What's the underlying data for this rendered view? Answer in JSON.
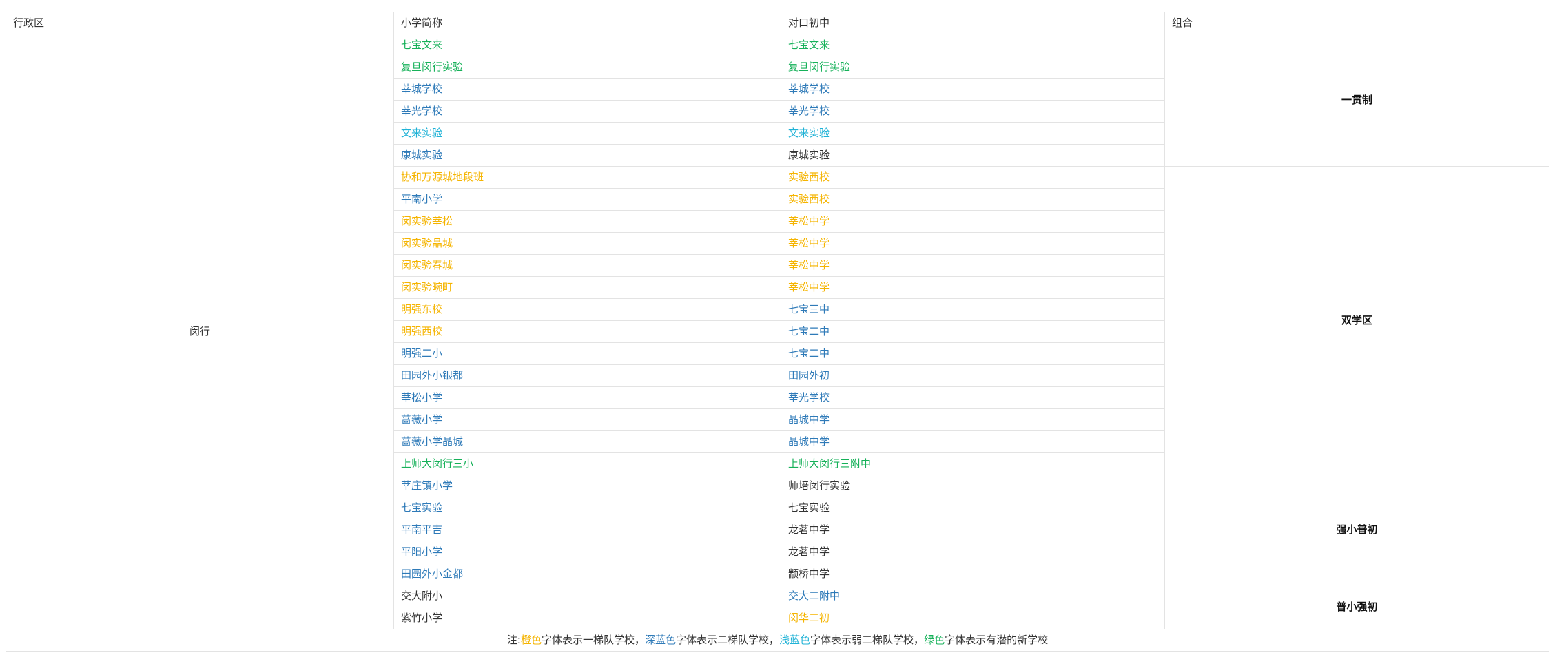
{
  "colors": {
    "orange": "#f5b400",
    "dark_blue": "#2e7ab8",
    "light_blue": "#1fb2d6",
    "green": "#16b159",
    "black": "#333333"
  },
  "table": {
    "headers": [
      "行政区",
      "小学简称",
      "对口初中",
      "组合"
    ],
    "district": "闵行",
    "groups": [
      "一贯制",
      "双学区",
      "强小普初",
      "普小强初"
    ],
    "rows": [
      {
        "primary": "七宝文来",
        "primary_color": "green",
        "middle": "七宝文来",
        "middle_color": "green"
      },
      {
        "primary": "复旦闵行实验",
        "primary_color": "green",
        "middle": "复旦闵行实验",
        "middle_color": "green"
      },
      {
        "primary": "莘城学校",
        "primary_color": "dark_blue",
        "middle": "莘城学校",
        "middle_color": "dark_blue"
      },
      {
        "primary": "莘光学校",
        "primary_color": "dark_blue",
        "middle": "莘光学校",
        "middle_color": "dark_blue"
      },
      {
        "primary": "文来实验",
        "primary_color": "light_blue",
        "middle": "文来实验",
        "middle_color": "light_blue"
      },
      {
        "primary": "康城实验",
        "primary_color": "dark_blue",
        "middle": "康城实验",
        "middle_color": "black"
      },
      {
        "primary": "协和万源城地段班",
        "primary_color": "orange",
        "middle": "实验西校",
        "middle_color": "orange"
      },
      {
        "primary": "平南小学",
        "primary_color": "dark_blue",
        "middle": "实验西校",
        "middle_color": "orange"
      },
      {
        "primary": "闵实验莘松",
        "primary_color": "orange",
        "middle": "莘松中学",
        "middle_color": "orange"
      },
      {
        "primary": "闵实验晶城",
        "primary_color": "orange",
        "middle": "莘松中学",
        "middle_color": "orange"
      },
      {
        "primary": "闵实验春城",
        "primary_color": "orange",
        "middle": "莘松中学",
        "middle_color": "orange"
      },
      {
        "primary": "闵实验畹町",
        "primary_color": "orange",
        "middle": "莘松中学",
        "middle_color": "orange"
      },
      {
        "primary": "明强东校",
        "primary_color": "orange",
        "middle": "七宝三中",
        "middle_color": "dark_blue"
      },
      {
        "primary": "明强西校",
        "primary_color": "orange",
        "middle": "七宝二中",
        "middle_color": "dark_blue"
      },
      {
        "primary": "明强二小",
        "primary_color": "dark_blue",
        "middle": "七宝二中",
        "middle_color": "dark_blue"
      },
      {
        "primary": "田园外小银都",
        "primary_color": "dark_blue",
        "middle": "田园外初",
        "middle_color": "dark_blue"
      },
      {
        "primary": "莘松小学",
        "primary_color": "dark_blue",
        "middle": "莘光学校",
        "middle_color": "dark_blue"
      },
      {
        "primary": "蔷薇小学",
        "primary_color": "dark_blue",
        "middle": "晶城中学",
        "middle_color": "dark_blue"
      },
      {
        "primary": "蔷薇小学晶城",
        "primary_color": "dark_blue",
        "middle": "晶城中学",
        "middle_color": "dark_blue"
      },
      {
        "primary": "上师大闵行三小",
        "primary_color": "green",
        "middle": "上师大闵行三附中",
        "middle_color": "green"
      },
      {
        "primary": "莘庄镇小学",
        "primary_color": "dark_blue",
        "middle": "师培闵行实验",
        "middle_color": "black"
      },
      {
        "primary": "七宝实验",
        "primary_color": "dark_blue",
        "middle": "七宝实验",
        "middle_color": "black"
      },
      {
        "primary": "平南平吉",
        "primary_color": "dark_blue",
        "middle": "龙茗中学",
        "middle_color": "black"
      },
      {
        "primary": "平阳小学",
        "primary_color": "dark_blue",
        "middle": "龙茗中学",
        "middle_color": "black"
      },
      {
        "primary": "田园外小金都",
        "primary_color": "dark_blue",
        "middle": "颛桥中学",
        "middle_color": "black"
      },
      {
        "primary": "交大附小",
        "primary_color": "black",
        "middle": "交大二附中",
        "middle_color": "dark_blue"
      },
      {
        "primary": "紫竹小学",
        "primary_color": "black",
        "middle": "闵华二初",
        "middle_color": "orange"
      }
    ]
  },
  "note": {
    "prefix": "注:",
    "orange_word": "橙色",
    "orange_text": "字体表示一梯队学校，",
    "dark_blue_word": "深蓝色",
    "dark_blue_text": "字体表示二梯队学校，",
    "light_blue_word": "浅蓝色",
    "light_blue_text": "字体表示弱二梯队学校，",
    "green_word": "绿色",
    "green_text": "字体表示有潜的新学校"
  }
}
